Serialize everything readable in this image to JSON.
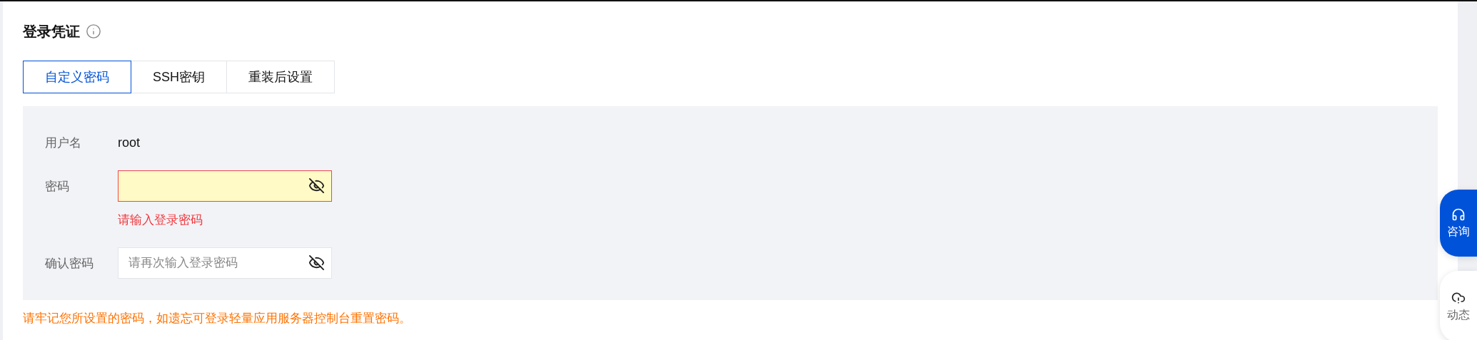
{
  "section": {
    "title": "登录凭证"
  },
  "tabs": [
    {
      "label": "自定义密码",
      "selected": true
    },
    {
      "label": "SSH密钥",
      "selected": false
    },
    {
      "label": "重装后设置",
      "selected": false
    }
  ],
  "form": {
    "fields": [
      {
        "kind": "text",
        "label": "用户名",
        "value": "root"
      },
      {
        "kind": "password",
        "label": "密码",
        "invalid": true,
        "error": "请输入登录密码"
      },
      {
        "kind": "password",
        "label": "确认密码",
        "placeholder": "请再次输入登录密码",
        "invalid": false
      }
    ]
  },
  "notice": "请牢记您所设置的密码，如遗忘可登录轻量应用服务器控制台重置密码。",
  "float_buttons": [
    {
      "kind": "consult",
      "label": "咨询",
      "selected": true
    },
    {
      "kind": "news",
      "label": "动态",
      "selected": false
    }
  ]
}
